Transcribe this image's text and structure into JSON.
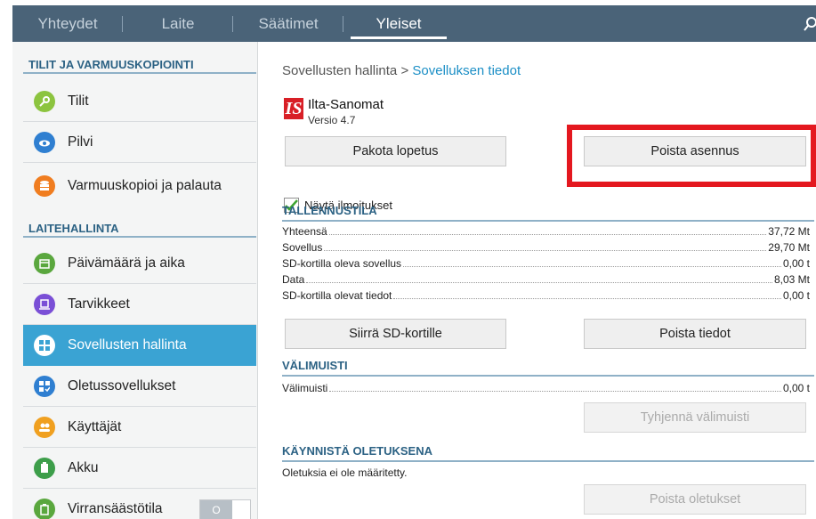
{
  "tabs": [
    {
      "label": "Yhteydet"
    },
    {
      "label": "Laite"
    },
    {
      "label": "Säätimet"
    },
    {
      "label": "Yleiset"
    }
  ],
  "sidebar": {
    "section1": "TILIT JA VARMUUSKOPIOINTI",
    "section2": "LAITEHALLINTA",
    "items": [
      {
        "label": "Tilit",
        "icon": "key-icon",
        "color": "#8cc43f"
      },
      {
        "label": "Pilvi",
        "icon": "cloud-icon",
        "color": "#2f7fd1"
      },
      {
        "label": "Varmuuskopioi ja palauta",
        "icon": "backup-icon",
        "color": "#f07d20"
      },
      {
        "label": "Päivämäärä ja aika",
        "icon": "calendar-icon",
        "color": "#5aa73e"
      },
      {
        "label": "Tarvikkeet",
        "icon": "accessory-icon",
        "color": "#7a4fd6"
      },
      {
        "label": "Sovellusten hallinta",
        "icon": "apps-grid-icon",
        "color": "#ffffff"
      },
      {
        "label": "Oletussovellukset",
        "icon": "default-apps-icon",
        "color": "#2f7fd1"
      },
      {
        "label": "Käyttäjät",
        "icon": "users-icon",
        "color": "#f0a020"
      },
      {
        "label": "Akku",
        "icon": "battery-icon",
        "color": "#3d9e4a"
      },
      {
        "label": "Virransäästötila",
        "icon": "power-saving-icon",
        "color": "#5aa73e"
      }
    ],
    "toggle_label": "O"
  },
  "main": {
    "breadcrumb_parent": "Sovellusten hallinta",
    "breadcrumb_sep": ">",
    "breadcrumb_current": "Sovelluksen tiedot",
    "app_logo": "IS",
    "app_name": "Ilta-Sanomat",
    "app_version": "Versio 4.7",
    "force_stop": "Pakota lopetus",
    "uninstall": "Poista asennus",
    "show_notifications": "Näytä ilmoitukset",
    "storage": {
      "title": "TALLENNUSTILA",
      "rows": [
        {
          "label": "Yhteensä",
          "value": "37,72 Mt"
        },
        {
          "label": "Sovellus",
          "value": "29,70 Mt"
        },
        {
          "label": "SD-kortilla oleva sovellus",
          "value": "0,00 t"
        },
        {
          "label": "Data",
          "value": "8,03 Mt"
        },
        {
          "label": "SD-kortilla olevat tiedot",
          "value": "0,00 t"
        }
      ],
      "move_sd": "Siirrä SD-kortille",
      "clear_data": "Poista tiedot"
    },
    "cache": {
      "title": "VÄLIMUISTI",
      "label": "Välimuisti",
      "value": "0,00 t",
      "clear_cache": "Tyhjennä välimuisti"
    },
    "launch_default": {
      "title": "KÄYNNISTÄ OLETUKSENA",
      "text": "Oletuksia ei ole määritetty.",
      "clear_defaults": "Poista oletukset"
    }
  }
}
